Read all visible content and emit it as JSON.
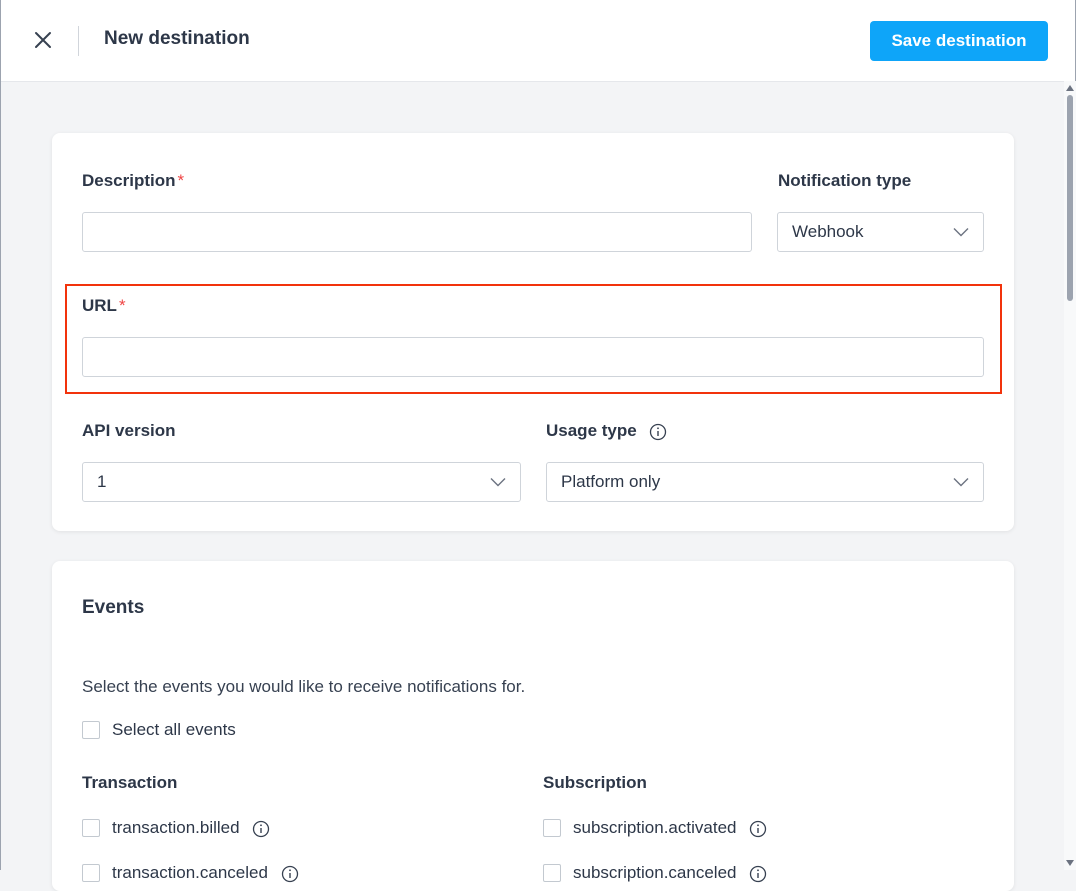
{
  "header": {
    "title": "New destination",
    "save_label": "Save destination"
  },
  "form": {
    "description": {
      "label": "Description",
      "required_mark": "*",
      "value": ""
    },
    "notification_type": {
      "label": "Notification type",
      "value": "Webhook"
    },
    "url": {
      "label": "URL",
      "required_mark": "*",
      "value": ""
    },
    "api_version": {
      "label": "API version",
      "value": "1"
    },
    "usage_type": {
      "label": "Usage type",
      "value": "Platform only"
    }
  },
  "events": {
    "title": "Events",
    "description": "Select the events you would like to receive notifications for.",
    "select_all_label": "Select all events",
    "groups": [
      {
        "title": "Transaction",
        "items": [
          {
            "label": "transaction.billed"
          },
          {
            "label": "transaction.canceled"
          }
        ]
      },
      {
        "title": "Subscription",
        "items": [
          {
            "label": "subscription.activated"
          },
          {
            "label": "subscription.canceled"
          }
        ]
      }
    ]
  },
  "colors": {
    "accent": "#0ea5f9",
    "highlight": "#f2330c",
    "required": "#ef4444"
  },
  "icons": {
    "close": "close-icon",
    "chevron": "chevron-down-icon",
    "info": "info-icon"
  }
}
